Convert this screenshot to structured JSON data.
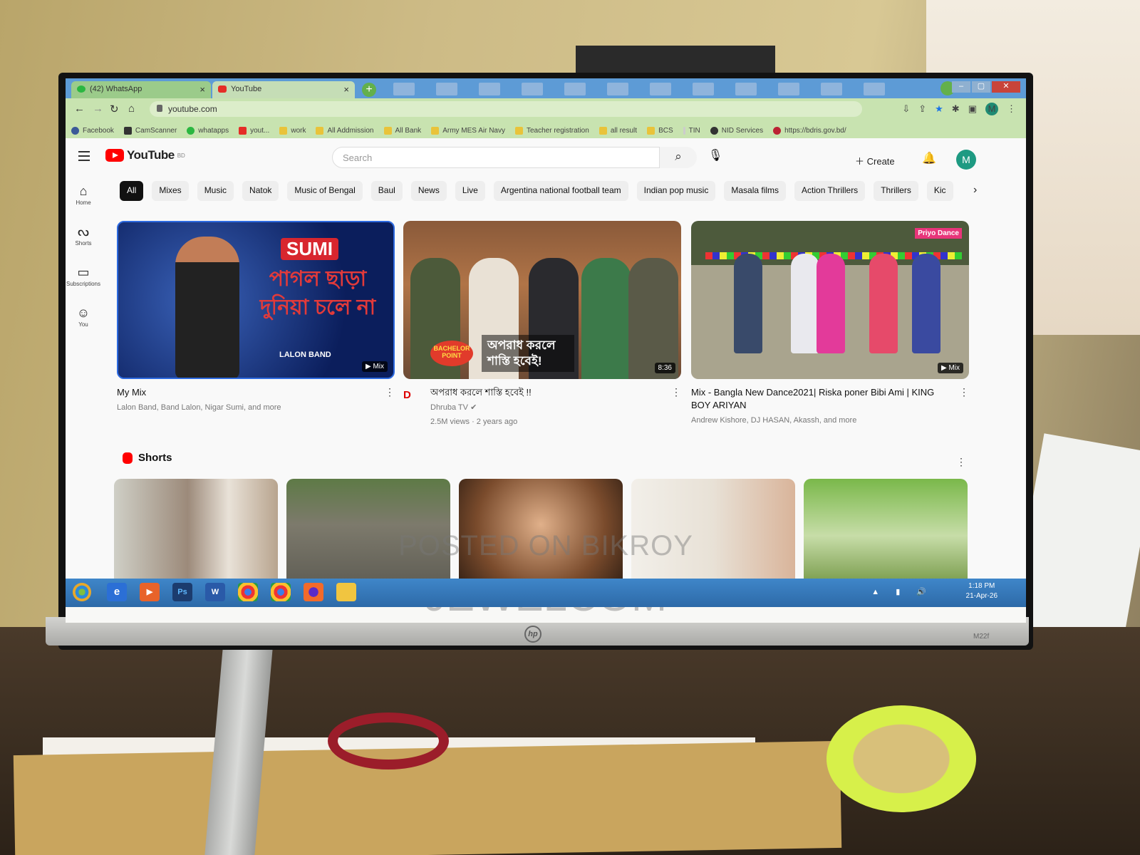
{
  "browser": {
    "tabs": [
      {
        "label": "(42) WhatsApp"
      },
      {
        "label": "YouTube"
      }
    ],
    "close_glyph": "×",
    "new_tab_glyph": "+",
    "url": "youtube.com",
    "profile_initial": "M",
    "bookmarks": [
      {
        "label": "Facebook"
      },
      {
        "label": "CamScanner"
      },
      {
        "label": "whatapps"
      },
      {
        "label": "yout..."
      },
      {
        "label": "work"
      },
      {
        "label": "All Addmission"
      },
      {
        "label": "All Bank"
      },
      {
        "label": "Army MES Air Navy"
      },
      {
        "label": "Teacher registration"
      },
      {
        "label": "all result"
      },
      {
        "label": "BCS"
      },
      {
        "label": "TIN"
      },
      {
        "label": "NID Services"
      },
      {
        "label": "https://bdris.gov.bd/"
      }
    ]
  },
  "youtube": {
    "logo_text": "YouTube",
    "region": "BD",
    "search_placeholder": "Search",
    "create_label": "Create",
    "avatar_initial": "M",
    "sidebar": [
      {
        "label": "Home"
      },
      {
        "label": "Shorts"
      },
      {
        "label": "Subscriptions"
      },
      {
        "label": "You"
      }
    ],
    "chips": [
      "All",
      "Mixes",
      "Music",
      "Natok",
      "Music of Bengal",
      "Baul",
      "News",
      "Live",
      "Argentina national football team",
      "Indian pop music",
      "Masala films",
      "Action Thrillers",
      "Thrillers",
      "Kic"
    ],
    "videos": [
      {
        "title": "My Mix",
        "meta1": "Lalon Band, Band Lalon, Nigar Sumi, and more",
        "meta2": "",
        "badge": "▶ Mix",
        "thumb_text": "SUMI",
        "thumb_bengali": "পাগল ছাড়া দুনিয়া চলে না",
        "thumb_band": "LALON BAND"
      },
      {
        "title": "অপরাধ করলে শাস্তি হবেই !!",
        "meta1": "Dhruba TV",
        "meta2": "2.5M views · 2 years ago",
        "badge": "8:36",
        "thumb_caption": "অপরাধ করলে শাস্তি হবেই!",
        "thumb_logo": "BACHELOR POINT",
        "channel_logo": "D"
      },
      {
        "title": "Mix - Bangla New Dance2021| Riska poner Bibi Ami | KING BOY ARIYAN",
        "meta1": "Andrew Kishore, DJ HASAN, Akassh, and more",
        "meta2": "",
        "badge": "▶ Mix",
        "thumb_tag": "Priyo Dance"
      }
    ],
    "shorts_title": "Shorts",
    "watermark_line1": "POSTED ON BIKROY",
    "watermark_line2": "JEWELCOM"
  },
  "taskbar": {
    "apps": [
      "Ps",
      "W"
    ],
    "time": "1:18 PM",
    "date": "21-Apr-26"
  },
  "monitor": {
    "brand": "hp",
    "model": "M22f"
  },
  "colors": {
    "youtube_red": "#ff0000",
    "tab_bar": "#5d9bd6",
    "address_bar": "#c8e3b0",
    "taskbar": "#2d6aa8"
  }
}
